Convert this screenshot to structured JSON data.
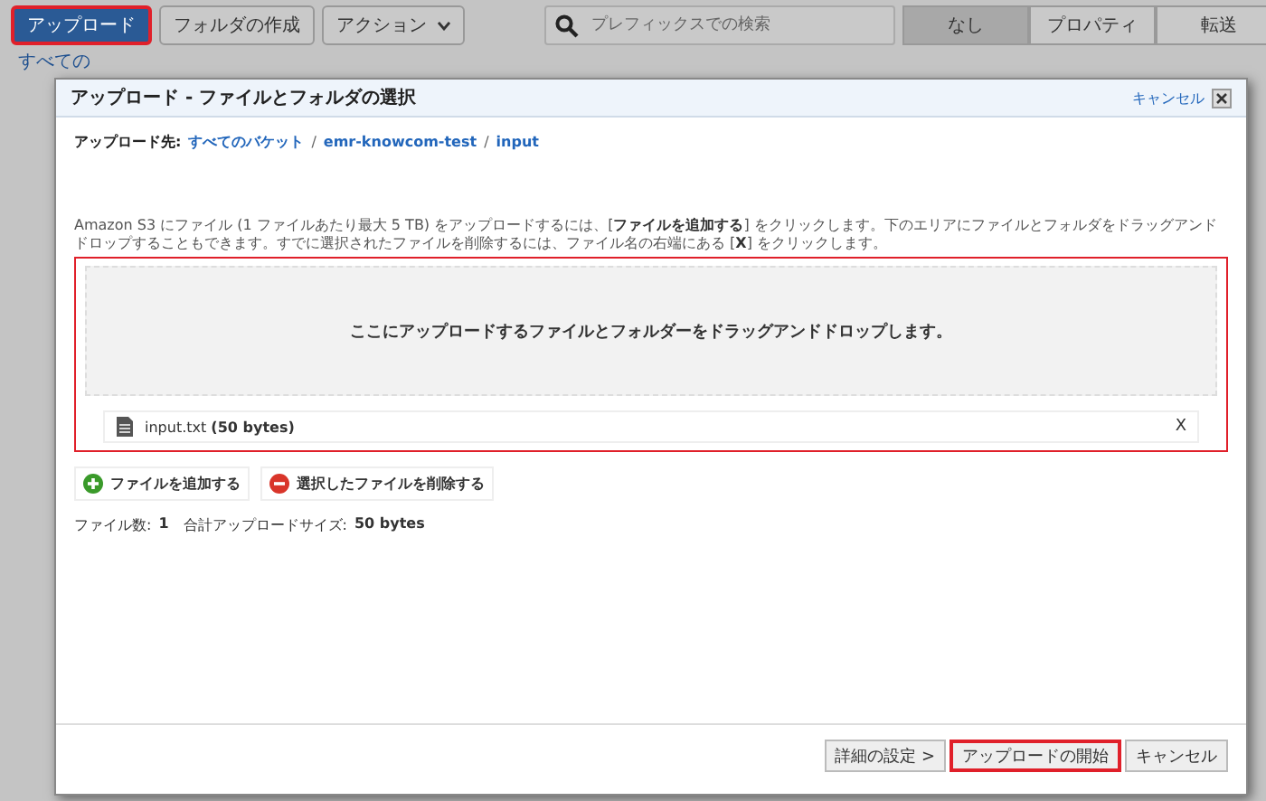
{
  "toolbar": {
    "buttons": [
      {
        "label": "アップロード",
        "kind": "primary",
        "highlighted": true
      },
      {
        "label": "フォルダの作成",
        "kind": "plain",
        "highlighted": false
      },
      {
        "label": "アクション",
        "kind": "dropdown",
        "highlighted": false
      }
    ],
    "search": {
      "placeholder": "プレフィックスでの検索"
    },
    "tabs": [
      {
        "label": "なし",
        "selected": true
      },
      {
        "label": "プロパティ",
        "selected": false
      },
      {
        "label": "転送",
        "selected": false
      }
    ]
  },
  "background": {
    "breadcrumb": "すべての"
  },
  "dialog": {
    "title": "アップロード - ファイルとフォルダの選択",
    "cancel_link": "キャンセル",
    "destination_label": "アップロード先:",
    "path_separator": "/",
    "path": [
      "すべてのバケット",
      "emr-knowcom-test",
      "input"
    ],
    "instructions": "Amazon S3 にファイル (1 ファイルあたり最大 5 TB) をアップロードするには、[**ファイルを追加する**] をクリックします。下のエリアにファイルとフォルダをドラッグアンドドロップすることもできます。すでに選択されたファイルを削除するには、ファイル名の右端にある [**X**] をクリックします。",
    "drop_zone": {
      "text": "ここにアップロードするファイルとフォルダーをドラッグアンドドロップします。",
      "highlighted": true
    },
    "files": [
      {
        "name": "input.txt",
        "size": "(50 bytes)",
        "remove": "X"
      }
    ],
    "actions": [
      {
        "label": "ファイルを追加する",
        "kind": "add"
      },
      {
        "label": "選択したファイルを削除する",
        "kind": "remove"
      }
    ],
    "summary": {
      "count_label": "ファイル数:",
      "count": "1",
      "size_label": "合計アップロードサイズ:",
      "size": "50 bytes"
    },
    "footer": [
      {
        "label": "詳細の設定 >",
        "highlighted": false
      },
      {
        "label": "アップロードの開始",
        "highlighted": true
      },
      {
        "label": "キャンセル",
        "highlighted": false
      }
    ]
  }
}
